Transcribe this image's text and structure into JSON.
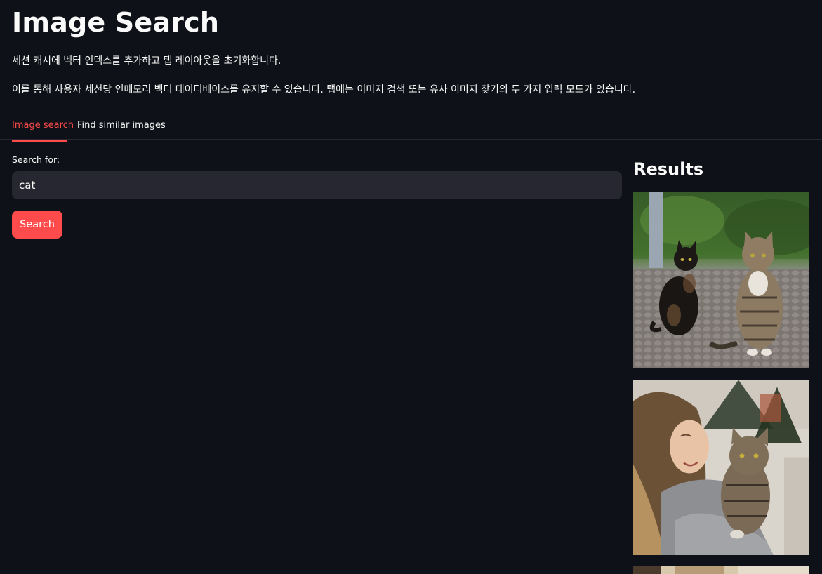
{
  "header": {
    "title": "Image Search",
    "description_1": "세션 캐시에 벡터 인덱스를 추가하고 탭 레이아웃을 초기화합니다.",
    "description_2": "이를 통해 사용자 세션당 인메모리 벡터 데이터베이스를 유지할 수 있습니다. 탭에는 이미지 검색 또는 유사 이미지 찾기의 두 가지 입력 모드가 있습니다."
  },
  "tabs": [
    {
      "label": "Image search",
      "active": true
    },
    {
      "label": "Find similar images",
      "active": false
    }
  ],
  "search": {
    "label": "Search for:",
    "value": "cat",
    "button_label": "Search"
  },
  "results": {
    "title": "Results",
    "images": [
      {
        "name": "two-cats-on-cobblestone-photo"
      },
      {
        "name": "woman-holding-tabby-cat-photo"
      },
      {
        "name": "cat-result-photo-partial"
      }
    ]
  },
  "colors": {
    "background": "#0e1117",
    "accent": "#ff4b4b",
    "input_bg": "#262730",
    "text": "#fafafa"
  }
}
